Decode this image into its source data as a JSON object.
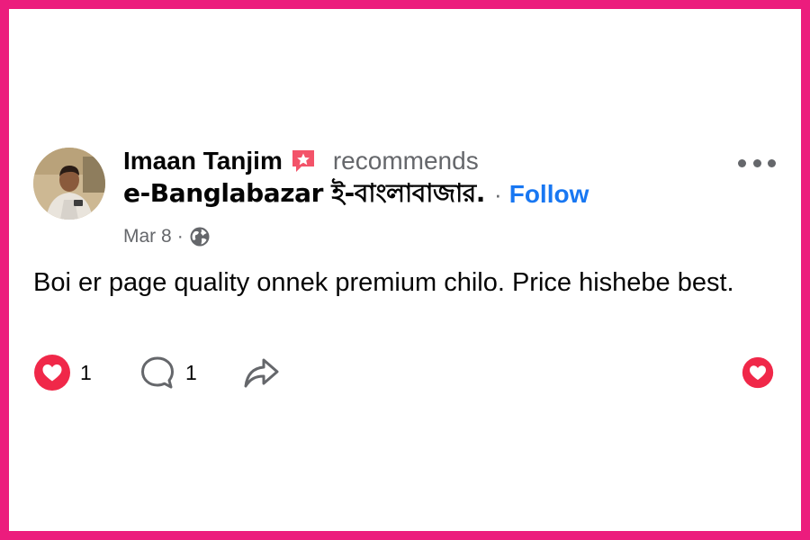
{
  "post": {
    "author_name": "Imaan Tanjim",
    "action_text": "recommends",
    "page_name": "e-Banglabazar ই-বাংলাবাজার.",
    "separator": "·",
    "follow_label": "Follow",
    "date": "Mar 8",
    "date_separator": "·",
    "body_text": "Boi er page quality onnek premium chilo. Price hishebe best."
  },
  "actions": {
    "reaction_count": "1",
    "comment_count": "1"
  },
  "icons": {
    "badge": "recommend-star-icon",
    "audience": "globe-icon",
    "more": "more-options-icon",
    "reaction": "love-reaction-icon",
    "comment": "comment-icon",
    "share": "share-icon"
  },
  "colors": {
    "border": "#ec1c7d",
    "follow": "#1877f2",
    "reaction": "#f02849",
    "secondary_text": "#65676b"
  }
}
